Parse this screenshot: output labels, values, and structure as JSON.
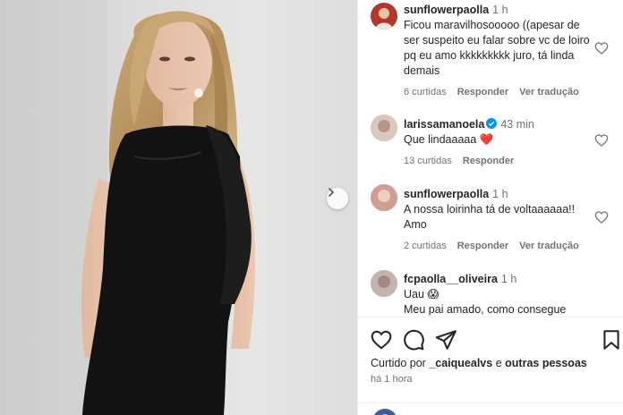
{
  "comments": [
    {
      "username": "sunflowerpaolla",
      "time": "1 h",
      "text": "Ficou maravilhosooooo ((apesar de ser suspeito eu falar sobre vc de loiro pq eu amo kkkkkkkkk juro, tá linda demais",
      "likes": "6 curtidas",
      "reply": "Responder",
      "translate": "Ver tradução"
    },
    {
      "username": "larissamanoela",
      "time": "43 min",
      "text": "Que lindaaaaa",
      "emoji": "❤️",
      "likes": "13 curtidas",
      "reply": "Responder"
    },
    {
      "username": "sunflowerpaolla",
      "time": "1 h",
      "text": "A nossa loirinha tá de voltaaaaaa!! Amo",
      "likes": "2 curtidas",
      "reply": "Responder",
      "translate": "Ver tradução"
    },
    {
      "username": "fcpaolla__oliveira",
      "time": "1 h",
      "text": "Uau",
      "emoji": "😱",
      "text2": "Meu pai amado, como consegue"
    }
  ],
  "liked_by": {
    "prefix": "Curtido por",
    "user": "_caiquealvs",
    "joiner": "e",
    "others": "outras pessoas"
  },
  "posted_time": "há 1 hora",
  "icons": {
    "like": "heart-icon",
    "comment": "comment-icon",
    "share": "share-icon",
    "save": "bookmark-icon",
    "next": "chevron-right-icon"
  },
  "colors": {
    "verified": "#0095f6",
    "text": "#262626",
    "muted": "#737373",
    "heart_red": "#ed4956"
  }
}
